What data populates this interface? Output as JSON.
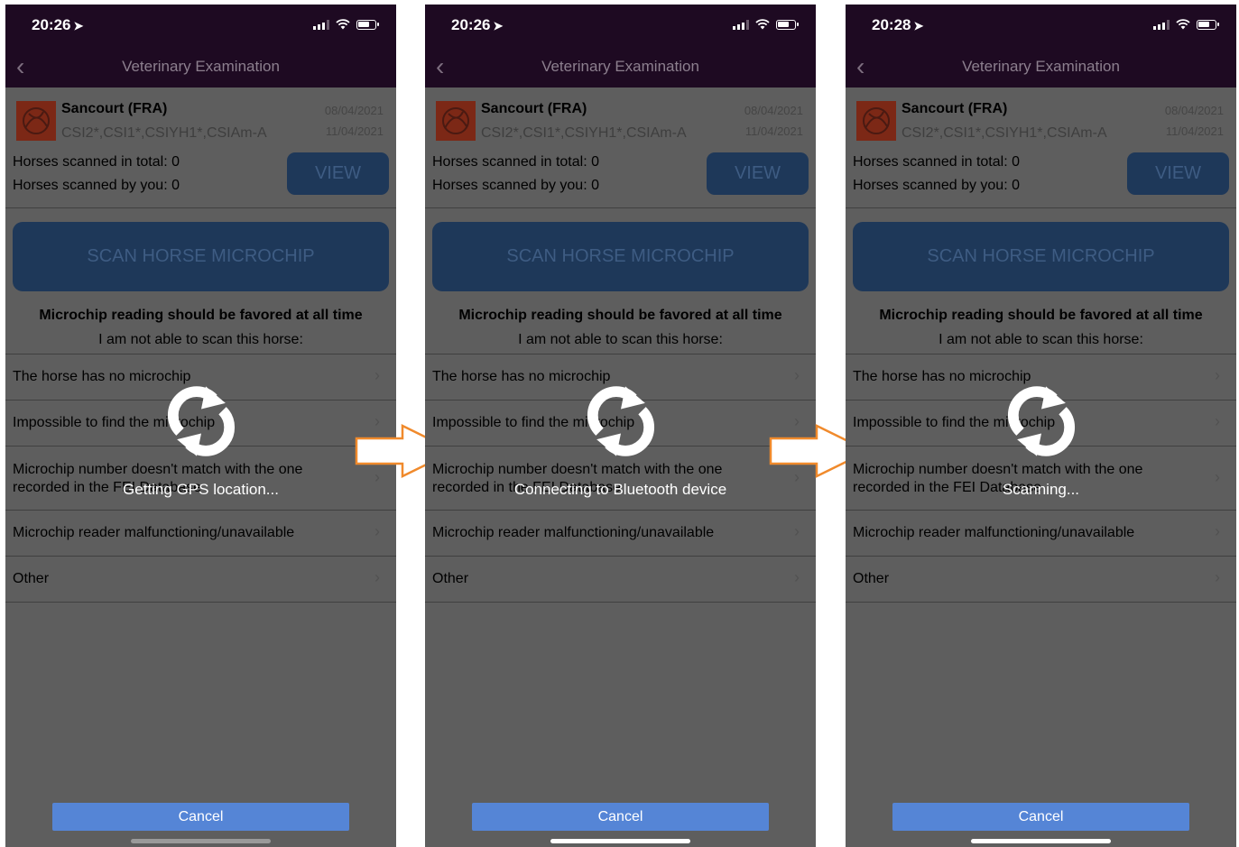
{
  "phones": [
    {
      "time": "20:26",
      "nav_title": "Veterinary Examination",
      "event": {
        "name": "Sancourt  (FRA)",
        "codes": "CSI2*,CSI1*,CSIYH1*,CSIAm-A",
        "date_start": "08/04/2021",
        "date_end": "11/04/2021"
      },
      "counts": {
        "total": "Horses scanned in total: 0",
        "by_you": "Horses scanned by you: 0"
      },
      "view_label": "VIEW",
      "scan_label": "SCAN HORSE MICROCHIP",
      "warning": "Microchip reading should be favored at all time",
      "subtitle": "I am not able to scan this horse:",
      "options": [
        "The horse has no microchip",
        "Impossible to find the microchip",
        "Microchip number doesn't match with the one recorded in the FEI Database",
        "Microchip reader malfunctioning/unavailable",
        "Other"
      ],
      "loading_text": "Getting GPS location...",
      "cancel_label": "Cancel"
    },
    {
      "time": "20:26",
      "nav_title": "Veterinary Examination",
      "event": {
        "name": "Sancourt  (FRA)",
        "codes": "CSI2*,CSI1*,CSIYH1*,CSIAm-A",
        "date_start": "08/04/2021",
        "date_end": "11/04/2021"
      },
      "counts": {
        "total": "Horses scanned in total: 0",
        "by_you": "Horses scanned by you: 0"
      },
      "view_label": "VIEW",
      "scan_label": "SCAN HORSE MICROCHIP",
      "warning": "Microchip reading should be favored at all time",
      "subtitle": "I am not able to scan this horse:",
      "options": [
        "The horse has no microchip",
        "Impossible to find the microchip",
        "Microchip number doesn't match with the one recorded in the FEI Database",
        "Microchip reader malfunctioning/unavailable",
        "Other"
      ],
      "loading_text": "Connecting to Bluetooth device",
      "cancel_label": "Cancel"
    },
    {
      "time": "20:28",
      "nav_title": "Veterinary Examination",
      "event": {
        "name": "Sancourt  (FRA)",
        "codes": "CSI2*,CSI1*,CSIYH1*,CSIAm-A",
        "date_start": "08/04/2021",
        "date_end": "11/04/2021"
      },
      "counts": {
        "total": "Horses scanned in total: 0",
        "by_you": "Horses scanned by you: 0"
      },
      "view_label": "VIEW",
      "scan_label": "SCAN HORSE MICROCHIP",
      "warning": "Microchip reading should be favored at all time",
      "subtitle": "I am not able to scan this horse:",
      "options": [
        "The horse has no microchip",
        "Impossible to find the microchip",
        "Microchip number doesn't match with the one recorded in the FEI Database",
        "Microchip reader malfunctioning/unavailable",
        "Other"
      ],
      "loading_text": "Scanning...",
      "cancel_label": "Cancel"
    }
  ],
  "colors": {
    "nav_bar": "#1e0a22",
    "overlay_gray": "#5e5e5e",
    "button_dark_blue": "#1e3859",
    "cancel_blue": "#5585d6",
    "arrow_orange": "#f08a2c"
  }
}
